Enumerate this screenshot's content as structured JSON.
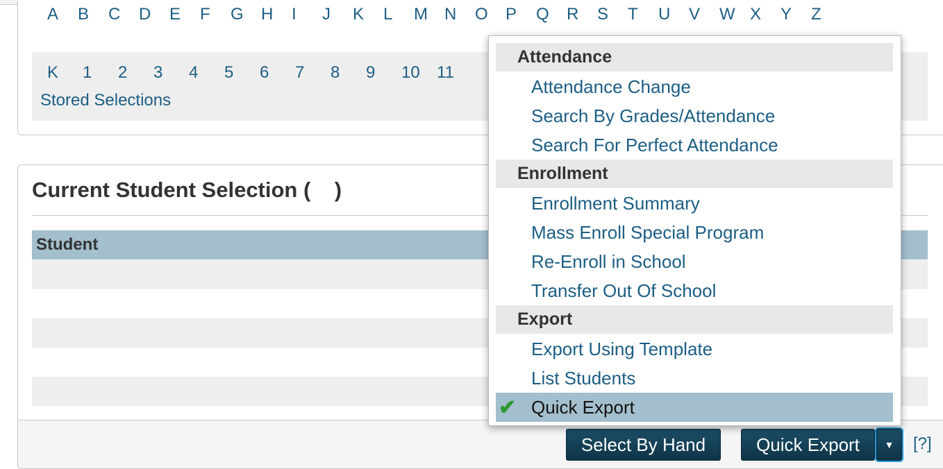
{
  "letters": [
    "A",
    "B",
    "C",
    "D",
    "E",
    "F",
    "G",
    "H",
    "I",
    "J",
    "K",
    "L",
    "M",
    "N",
    "O",
    "P",
    "Q",
    "R",
    "S",
    "T",
    "U",
    "V",
    "W",
    "X",
    "Y",
    "Z"
  ],
  "grades": [
    "K",
    "1",
    "2",
    "3",
    "4",
    "5",
    "6",
    "7",
    "8",
    "9",
    "10",
    "11"
  ],
  "stored_selections": "Stored Selections",
  "selection": {
    "title": "Current Student Selection (    )",
    "column_header": "Student"
  },
  "footer": {
    "select_by_hand": "Select By Hand",
    "quick_export": "Quick Export",
    "help": "[?]"
  },
  "menu": {
    "groups": [
      {
        "header": "Attendance",
        "items": [
          "Attendance Change",
          "Search By Grades/Attendance",
          "Search For Perfect Attendance"
        ]
      },
      {
        "header": "Enrollment",
        "items": [
          "Enrollment Summary",
          "Mass Enroll Special Program",
          "Re-Enroll in School",
          "Transfer Out Of School"
        ]
      },
      {
        "header": "Export",
        "items": [
          "Export Using Template",
          "List Students",
          "Quick Export"
        ]
      }
    ],
    "selected": "Quick Export"
  },
  "colors": {
    "link": "#1c5e84",
    "button": "#133f55",
    "header_row": "#a3bfcd",
    "check": "#2c9a2c"
  }
}
